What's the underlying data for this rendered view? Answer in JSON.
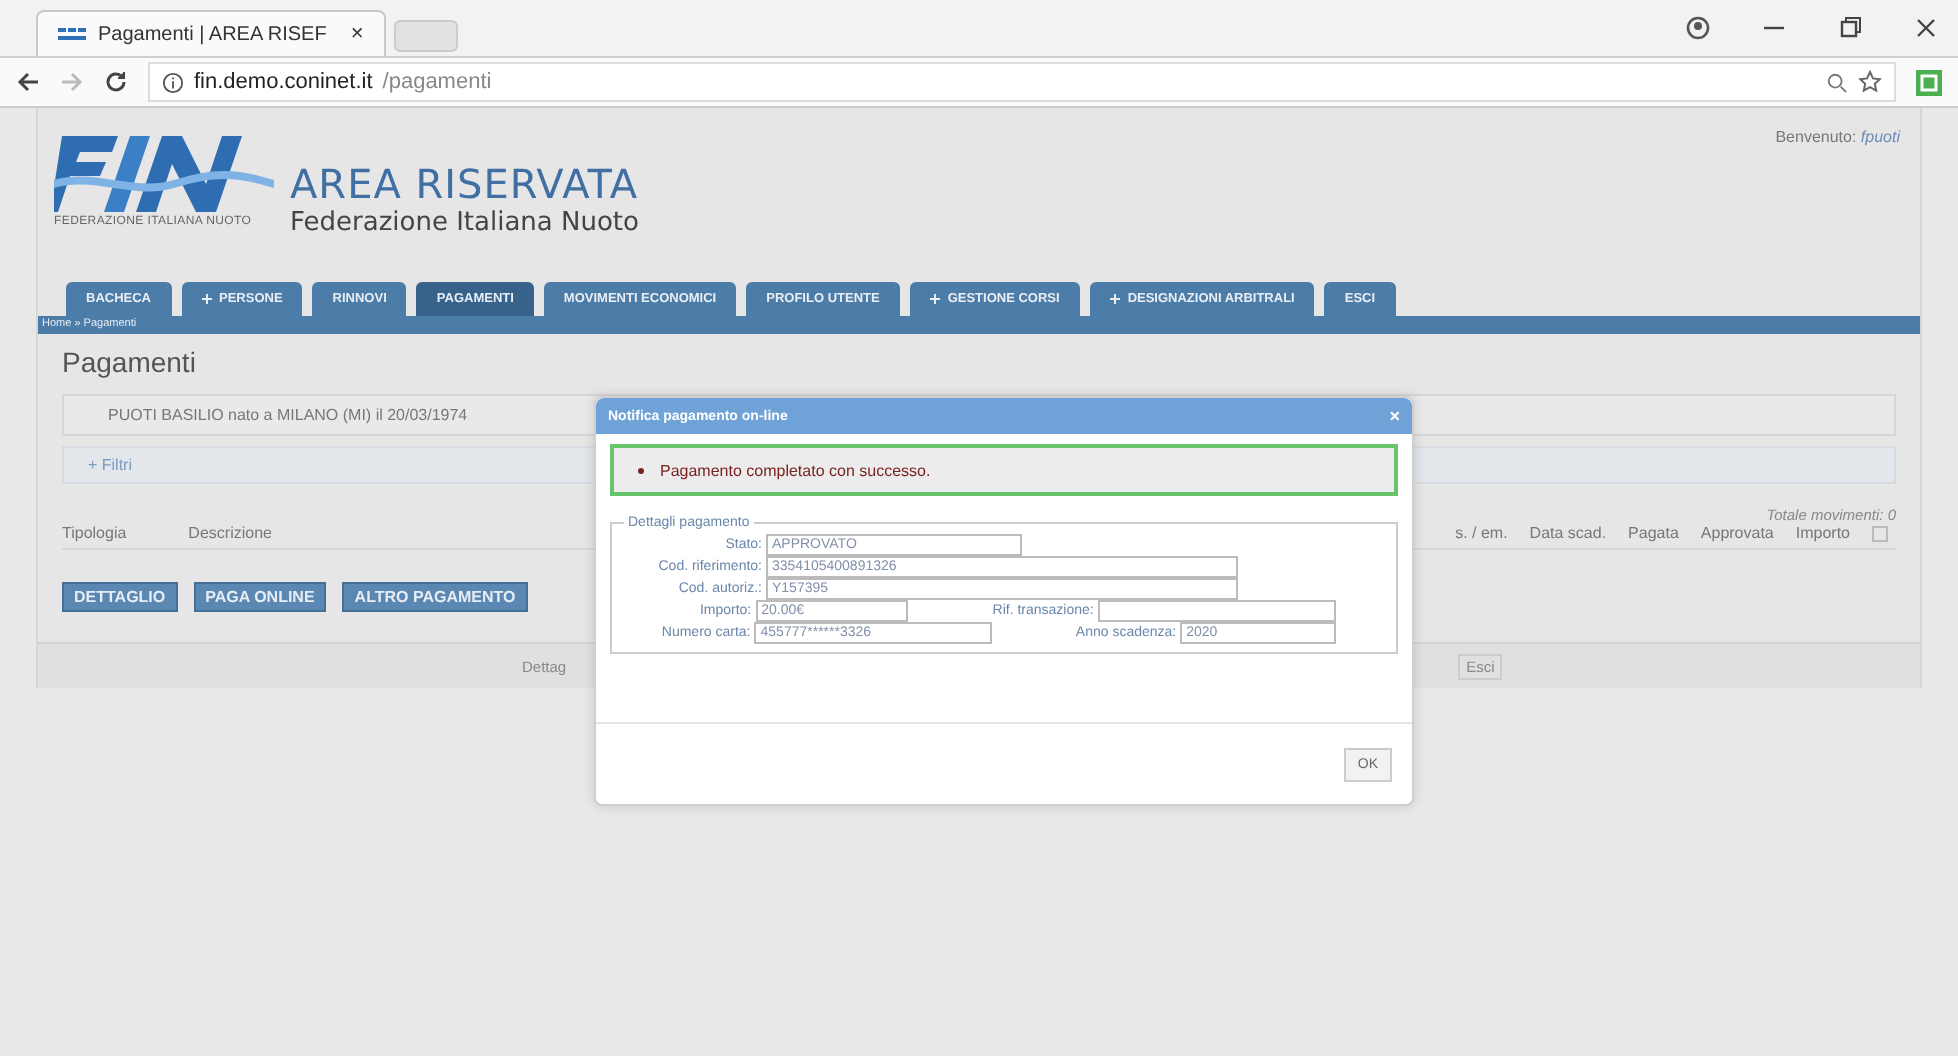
{
  "browser": {
    "tabs": [
      {
        "title": "Pagamenti | AREA RISEF",
        "close": "×",
        "selected": true
      }
    ],
    "url_host": "fin.demo.coninet.it",
    "url_path": "/pagamenti"
  },
  "header": {
    "logo_caption": "FEDERAZIONE ITALIANA NUOTO",
    "title": "AREA RISERVATA",
    "subtitle": "Federazione Italiana Nuoto",
    "welcome_label": "Benvenuto:",
    "welcome_user": "fpuoti"
  },
  "nav": [
    {
      "label": "BACHECA",
      "dropdown": false,
      "selected": false
    },
    {
      "label": "PERSONE",
      "dropdown": true,
      "selected": false
    },
    {
      "label": "RINNOVI",
      "dropdown": false,
      "selected": false
    },
    {
      "label": "PAGAMENTI",
      "dropdown": false,
      "selected": true
    },
    {
      "label": "MOVIMENTI ECONOMICI",
      "dropdown": false,
      "selected": false
    },
    {
      "label": "PROFILO UTENTE",
      "dropdown": false,
      "selected": false
    },
    {
      "label": "GESTIONE CORSI",
      "dropdown": true,
      "selected": false
    },
    {
      "label": "DESIGNAZIONI ARBITRALI",
      "dropdown": true,
      "selected": false
    },
    {
      "label": "ESCI",
      "dropdown": false,
      "selected": false
    }
  ],
  "breadcrumb": "Home » Pagamenti",
  "page_title": "Pagamenti",
  "person": "PUOTI BASILIO nato a MILANO (MI) il 20/03/1974",
  "filters": "+ Filtri",
  "table": {
    "total": "Totale movimenti: 0",
    "columns_left": [
      "Tipologia",
      "Descrizione"
    ],
    "columns_right": [
      "s. / em.",
      "Data scad.",
      "Pagata",
      "Approvata",
      "Importo"
    ],
    "select_all_checked": false
  },
  "actions": [
    "DETTAGLIO",
    "PAGA ONLINE",
    "ALTRO PAGAMENTO"
  ],
  "footer": {
    "left": "Dettag",
    "right": "Esci"
  },
  "dialog": {
    "title": "Notifica pagamento on-line",
    "close": "×",
    "message": "Pagamento completato con successo.",
    "legend": "Dettagli pagamento",
    "rows": [
      [
        {
          "label": "Stato:",
          "value": "APPROVATO"
        }
      ],
      [
        {
          "label": "Cod. riferimento:",
          "value": "3354105400891326"
        }
      ],
      [
        {
          "label": "Cod. autoriz.:",
          "value": "Y157395"
        }
      ],
      [
        {
          "label": "Importo:",
          "value": "20.00€"
        },
        {
          "label": "Rif. transazione:"
        }
      ],
      [
        {
          "label": "Numero carta:",
          "value": "455777******3326"
        },
        {
          "label": "Anno scadenza:",
          "value": "2020"
        }
      ]
    ],
    "ok": "OK"
  }
}
